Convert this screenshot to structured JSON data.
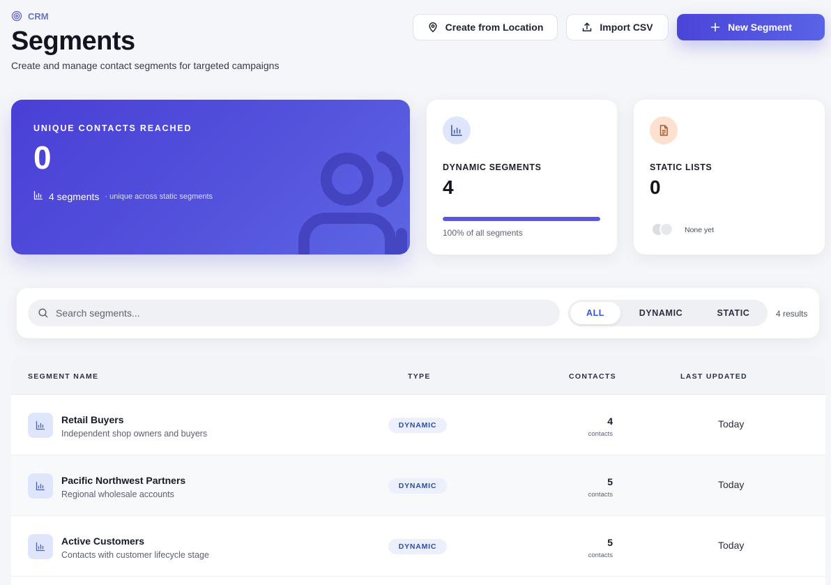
{
  "header": {
    "breadcrumb": "CRM",
    "title": "Segments",
    "subtitle": "Create and manage contact segments for targeted campaigns",
    "actions": {
      "create_from_location": "Create from Location",
      "import_csv": "Import CSV",
      "new_segment": "New Segment"
    }
  },
  "stats": {
    "hero": {
      "label": "UNIQUE CONTACTS REACHED",
      "value": "0",
      "segments_text": "4 segments",
      "segments_sub": "· unique across static segments"
    },
    "dynamic": {
      "label": "DYNAMIC SEGMENTS",
      "value": "4",
      "progress_fraction": 1.0,
      "footnote": "100% of all segments"
    },
    "static": {
      "label": "STATIC LISTS",
      "value": "0",
      "footnote": "None yet"
    }
  },
  "filters": {
    "search_placeholder": "Search segments...",
    "tabs": [
      "ALL",
      "DYNAMIC",
      "STATIC"
    ],
    "active_tab": "ALL",
    "result_count": "4 results"
  },
  "table": {
    "columns": {
      "name": "SEGMENT NAME",
      "type": "TYPE",
      "contacts": "CONTACTS",
      "last_updated": "LAST UPDATED"
    },
    "rows": [
      {
        "name": "Retail Buyers",
        "description": "Independent shop owners and buyers",
        "type": "DYNAMIC",
        "contacts": "4",
        "contacts_unit": "contacts",
        "updated": "Today"
      },
      {
        "name": "Pacific Northwest Partners",
        "description": "Regional wholesale accounts",
        "type": "DYNAMIC",
        "contacts": "5",
        "contacts_unit": "contacts",
        "updated": "Today"
      },
      {
        "name": "Active Customers",
        "description": "Contacts with customer lifecycle stage",
        "type": "DYNAMIC",
        "contacts": "5",
        "contacts_unit": "contacts",
        "updated": "Today"
      }
    ]
  },
  "colors": {
    "accent": "#4b45d8",
    "badge_text": "#2c4ca8",
    "dynamic_icon_bg": "#dfe6fb",
    "static_icon_bg": "#fde0cf"
  },
  "icons": {
    "breadcrumb": "target-icon",
    "location": "map-pin-icon",
    "import": "upload-icon",
    "new": "plus-icon",
    "dynamic": "bar-chart-icon",
    "static": "document-icon",
    "search": "search-icon"
  }
}
